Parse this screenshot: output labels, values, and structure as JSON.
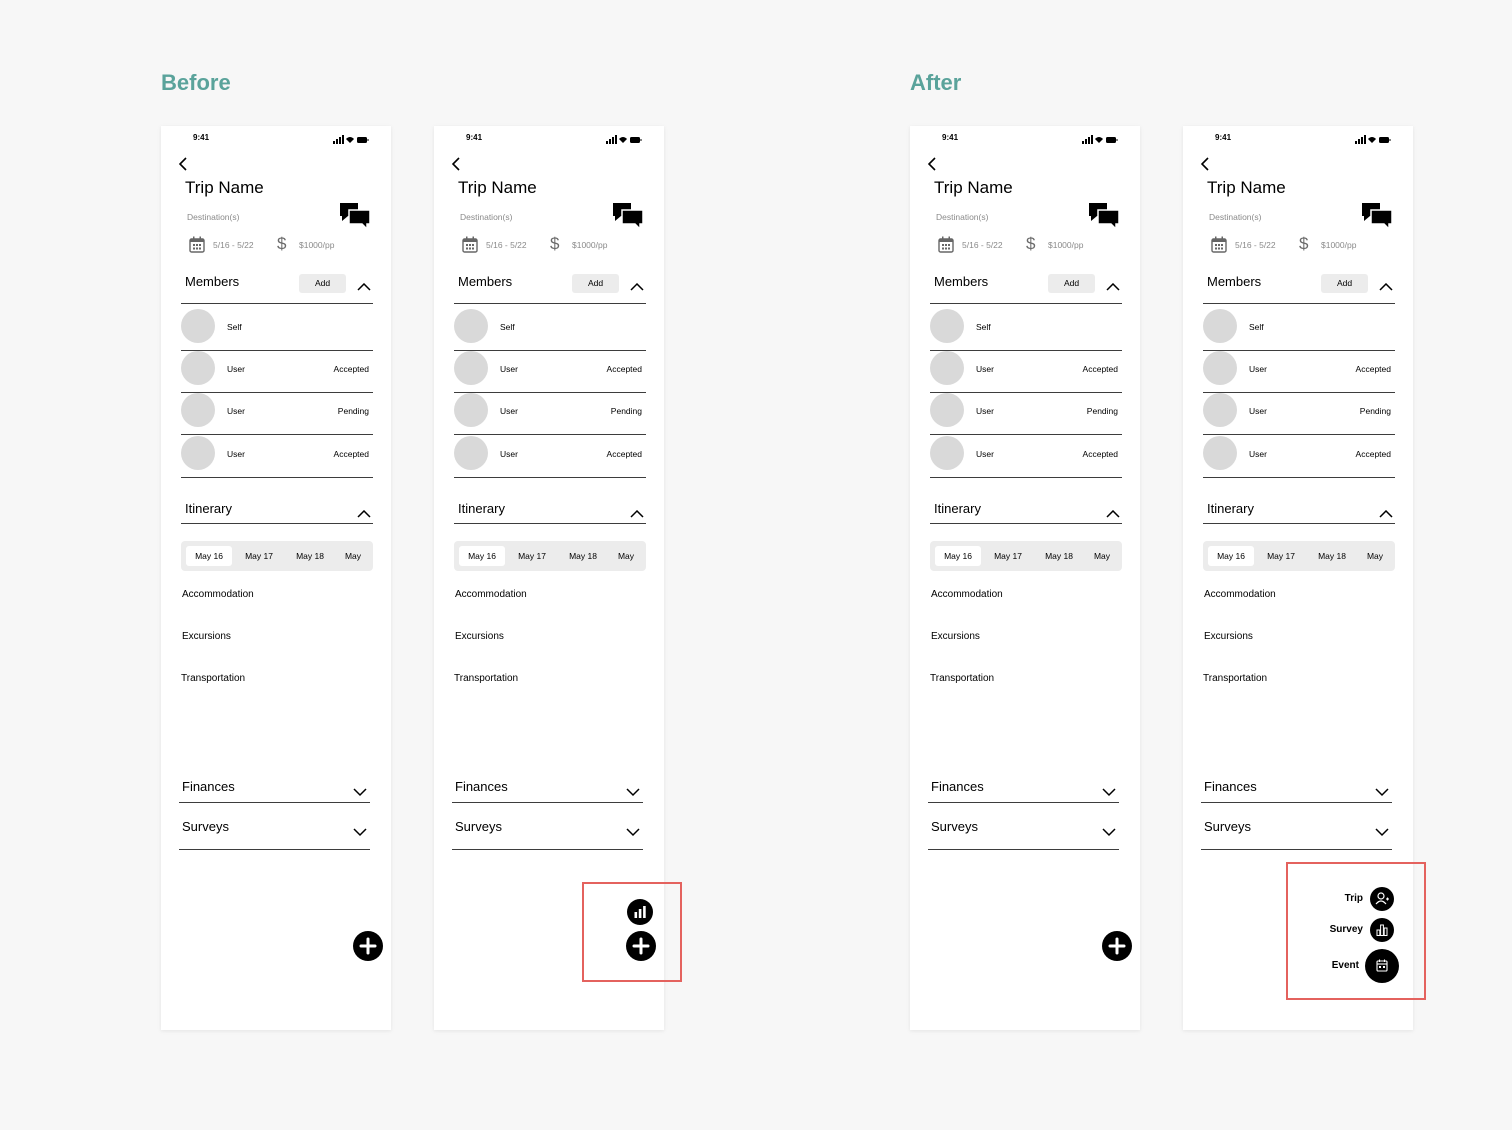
{
  "titles": {
    "before": "Before",
    "after": "After"
  },
  "screen": {
    "time": "9:41",
    "trip_name": "Trip Name",
    "destination": "Destination(s)",
    "date_range": "5/16 - 5/22",
    "budget": "$1000/pp",
    "members": {
      "title": "Members",
      "add_label": "Add",
      "rows": [
        {
          "name": "Self",
          "status": ""
        },
        {
          "name": "User",
          "status": "Accepted"
        },
        {
          "name": "User",
          "status": "Pending"
        },
        {
          "name": "User",
          "status": "Accepted"
        }
      ]
    },
    "itinerary": {
      "title": "Itinerary",
      "days": [
        "May 16",
        "May 17",
        "May 18",
        "May"
      ],
      "categories": [
        "Accommodation",
        "Excursions",
        "Transportation"
      ]
    },
    "finances_title": "Finances",
    "surveys_title": "Surveys"
  },
  "speed_dial": {
    "trip": "Trip",
    "survey": "Survey",
    "event": "Event"
  },
  "colors": {
    "heading": "#5aa39b",
    "highlight": "#e4625e"
  }
}
